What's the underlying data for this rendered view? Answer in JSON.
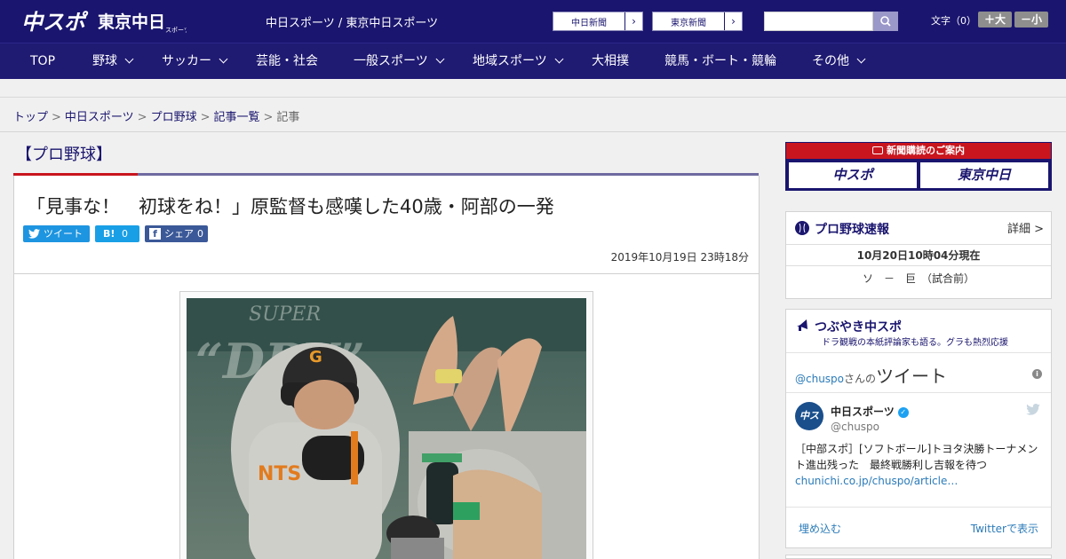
{
  "header": {
    "logo_chuspo": "中スポ",
    "logo_tokyo": "東京中日",
    "logo_tokyo_sub": "スポーツ",
    "site_title": "中日スポーツ / 東京中日スポーツ",
    "ext_links": [
      {
        "label": "中日新聞"
      },
      {
        "label": "東京新聞"
      }
    ],
    "search": {
      "placeholder": ""
    },
    "font_size": {
      "label": "文字（0）",
      "increase": "＋大",
      "decrease": "－小"
    }
  },
  "nav": {
    "items": [
      {
        "label": "TOP",
        "has_menu": false
      },
      {
        "label": "野球",
        "has_menu": true
      },
      {
        "label": "サッカー",
        "has_menu": true
      },
      {
        "label": "芸能・社会",
        "has_menu": false
      },
      {
        "label": "一般スポーツ",
        "has_menu": true
      },
      {
        "label": "地域スポーツ",
        "has_menu": true
      },
      {
        "label": "大相撲",
        "has_menu": false
      },
      {
        "label": "競馬・ボート・競輪",
        "has_menu": false
      },
      {
        "label": "その他",
        "has_menu": true
      }
    ]
  },
  "breadcrumb": {
    "items": [
      "トップ",
      "中日スポーツ",
      "プロ野球",
      "記事一覧"
    ],
    "current": "記事"
  },
  "article": {
    "section": "【プロ野球】",
    "headline": "「見事な！　初球をね！」原監督も感嘆した40歳・阿部の一発",
    "share": {
      "tweet": "ツイート",
      "hatena_label": "B!",
      "hatena_count": "0",
      "fb_label": "シェア",
      "fb_count": "0"
    },
    "date": "2019年10月19日 23時18分"
  },
  "sidebar": {
    "subscribe": {
      "title": "新聞購読のご案内",
      "buttons": [
        "中スポ",
        "東京中日"
      ]
    },
    "score": {
      "title": "プロ野球速報",
      "detail": "詳細 >",
      "time": "10月20日10時04分現在",
      "games": [
        "ソ　－　巨　（試合前）"
      ]
    },
    "tweets": {
      "title": "つぶやき中スポ",
      "subtitle": "ドラ観戦の本紙評論家も語る。グラも熱烈応援",
      "handle": "@chuspo",
      "handle_suffix": "さんの",
      "handle_big": "ツイート",
      "tweet": {
        "name": "中日スポーツ",
        "account": "@chuspo",
        "text": "［中部スポ］[ソフトボール]トヨタ決勝トーナメント進出残った　最終戦勝利し吉報を待つ",
        "link": "chunichi.co.jp/chuspo/article…"
      },
      "embed": "埋め込む",
      "view": "Twitterで表示"
    }
  },
  "colors": {
    "brand_navy": "#1a156e",
    "accent_red": "#c9151e"
  }
}
